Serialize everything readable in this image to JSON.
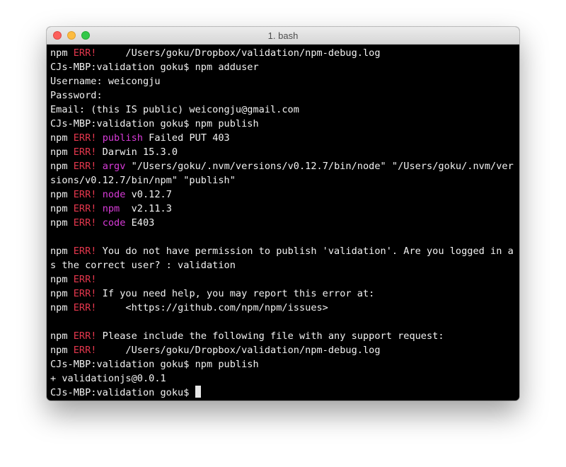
{
  "window": {
    "title": "1. bash"
  },
  "terminal": {
    "lines": [
      {
        "segments": [
          {
            "t": "npm "
          },
          {
            "t": "ERR!",
            "c": "err"
          },
          {
            "t": "     /Users/goku/Dropbox/validation/npm-debug.log"
          }
        ]
      },
      {
        "segments": [
          {
            "t": "CJs-MBP:validation goku$ npm adduser"
          }
        ]
      },
      {
        "segments": [
          {
            "t": "Username: weicongju"
          }
        ]
      },
      {
        "segments": [
          {
            "t": "Password:"
          }
        ]
      },
      {
        "segments": [
          {
            "t": "Email: (this IS public) weicongju@gmail.com"
          }
        ]
      },
      {
        "segments": [
          {
            "t": "CJs-MBP:validation goku$ npm publish"
          }
        ]
      },
      {
        "segments": [
          {
            "t": "npm "
          },
          {
            "t": "ERR!",
            "c": "err"
          },
          {
            "t": " "
          },
          {
            "t": "publish",
            "c": "mag"
          },
          {
            "t": " Failed PUT 403"
          }
        ]
      },
      {
        "segments": [
          {
            "t": "npm "
          },
          {
            "t": "ERR!",
            "c": "err"
          },
          {
            "t": " Darwin 15.3.0"
          }
        ]
      },
      {
        "segments": [
          {
            "t": "npm "
          },
          {
            "t": "ERR!",
            "c": "err"
          },
          {
            "t": " "
          },
          {
            "t": "argv",
            "c": "mag"
          },
          {
            "t": " \"/Users/goku/.nvm/versions/v0.12.7/bin/node\" \"/Users/goku/.nvm/ver"
          }
        ]
      },
      {
        "segments": [
          {
            "t": "sions/v0.12.7/bin/npm\" \"publish\""
          }
        ]
      },
      {
        "segments": [
          {
            "t": "npm "
          },
          {
            "t": "ERR!",
            "c": "err"
          },
          {
            "t": " "
          },
          {
            "t": "node",
            "c": "mag"
          },
          {
            "t": " v0.12.7"
          }
        ]
      },
      {
        "segments": [
          {
            "t": "npm "
          },
          {
            "t": "ERR!",
            "c": "err"
          },
          {
            "t": " "
          },
          {
            "t": "npm",
            "c": "mag"
          },
          {
            "t": "  v2.11.3"
          }
        ]
      },
      {
        "segments": [
          {
            "t": "npm "
          },
          {
            "t": "ERR!",
            "c": "err"
          },
          {
            "t": " "
          },
          {
            "t": "code",
            "c": "mag"
          },
          {
            "t": " E403"
          }
        ]
      },
      {
        "segments": []
      },
      {
        "segments": [
          {
            "t": "npm "
          },
          {
            "t": "ERR!",
            "c": "err"
          },
          {
            "t": " You do not have permission to publish 'validation'. Are you logged in a"
          }
        ]
      },
      {
        "segments": [
          {
            "t": "s the correct user? : validation"
          }
        ]
      },
      {
        "segments": [
          {
            "t": "npm "
          },
          {
            "t": "ERR!",
            "c": "err"
          }
        ]
      },
      {
        "segments": [
          {
            "t": "npm "
          },
          {
            "t": "ERR!",
            "c": "err"
          },
          {
            "t": " If you need help, you may report this error at:"
          }
        ]
      },
      {
        "segments": [
          {
            "t": "npm "
          },
          {
            "t": "ERR!",
            "c": "err"
          },
          {
            "t": "     <https://github.com/npm/npm/issues>"
          }
        ]
      },
      {
        "segments": []
      },
      {
        "segments": [
          {
            "t": "npm "
          },
          {
            "t": "ERR!",
            "c": "err"
          },
          {
            "t": " Please include the following file with any support request:"
          }
        ]
      },
      {
        "segments": [
          {
            "t": "npm "
          },
          {
            "t": "ERR!",
            "c": "err"
          },
          {
            "t": "     /Users/goku/Dropbox/validation/npm-debug.log"
          }
        ]
      },
      {
        "segments": [
          {
            "t": "CJs-MBP:validation goku$ npm publish"
          }
        ]
      },
      {
        "segments": [
          {
            "t": "+ validationjs@0.0.1"
          }
        ]
      },
      {
        "segments": [
          {
            "t": "CJs-MBP:validation goku$ "
          }
        ],
        "cursor": true
      }
    ]
  },
  "colors": {
    "background": "#000000",
    "text": "#f2f2f2",
    "err": "#e5374d",
    "keyword": "#d83bd8"
  }
}
